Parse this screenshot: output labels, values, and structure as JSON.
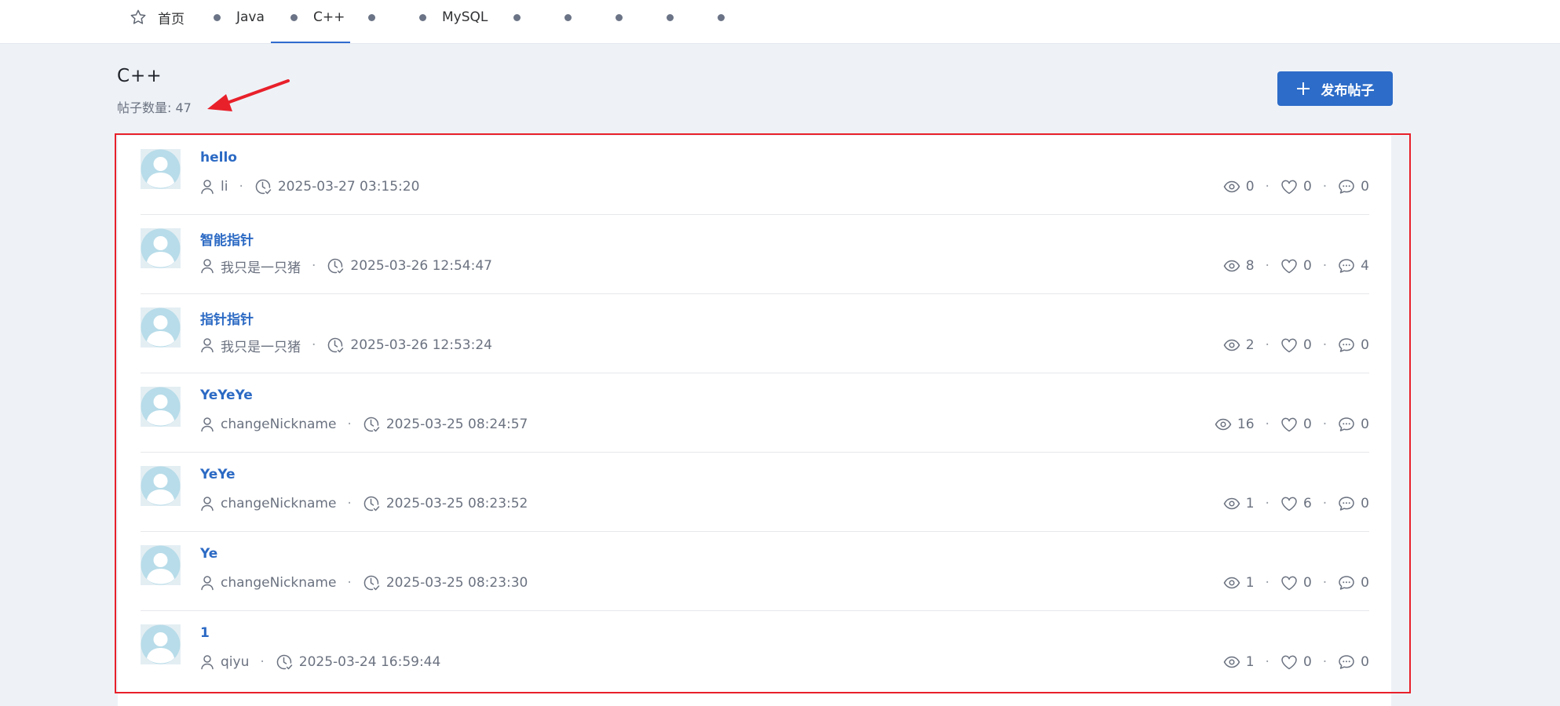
{
  "nav": {
    "home": "首页",
    "java": "Java",
    "cpp": "C++",
    "mysql": "MySQL"
  },
  "category": {
    "title": "C++",
    "count_text": "帖子数量: 47"
  },
  "publish_button": {
    "label": "发布帖子"
  },
  "colors": {
    "accent": "#2d6cc8",
    "highlight_frame": "#e8202a"
  },
  "posts": [
    {
      "title": "hello",
      "author": "li",
      "time": "2025-03-27 03:15:20",
      "views": "0",
      "likes": "0",
      "comments": "0"
    },
    {
      "title": "智能指针",
      "author": "我只是一只猪",
      "time": "2025-03-26 12:54:47",
      "views": "8",
      "likes": "0",
      "comments": "4"
    },
    {
      "title": "指针指针",
      "author": "我只是一只猪",
      "time": "2025-03-26 12:53:24",
      "views": "2",
      "likes": "0",
      "comments": "0"
    },
    {
      "title": "YeYeYe",
      "author": "changeNickname",
      "time": "2025-03-25 08:24:57",
      "views": "16",
      "likes": "0",
      "comments": "0"
    },
    {
      "title": "YeYe",
      "author": "changeNickname",
      "time": "2025-03-25 08:23:52",
      "views": "1",
      "likes": "6",
      "comments": "0"
    },
    {
      "title": "Ye",
      "author": "changeNickname",
      "time": "2025-03-25 08:23:30",
      "views": "1",
      "likes": "0",
      "comments": "0"
    },
    {
      "title": "1",
      "author": "qiyu",
      "time": "2025-03-24 16:59:44",
      "views": "1",
      "likes": "0",
      "comments": "0"
    }
  ]
}
